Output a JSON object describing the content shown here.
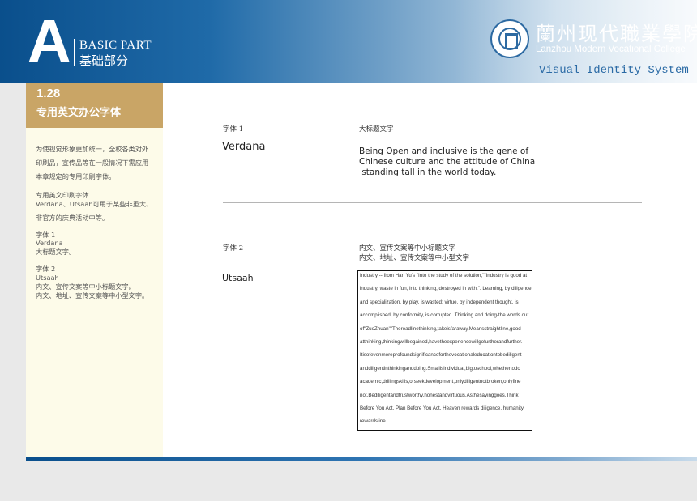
{
  "header": {
    "letter": "A",
    "part_en": "BASIC PART",
    "part_cn": "基础部分",
    "school_cn": "蘭州现代職業學院",
    "school_en": "Lanzhou Modern Vocational College",
    "system_title": "Visual Identity System"
  },
  "section": {
    "number": "1.28",
    "title": "专用英文办公字体"
  },
  "sidebar": {
    "para1": [
      "为使视觉形象更加统一，全校各类对外",
      "印刷品，宣传品等在一般情况下需应用",
      "本章规定的专用印刷字体。"
    ],
    "para2": [
      "专用英文印刷字体二",
      "Verdana、Utsaah可用于某些非重大、",
      "非官方的庆典活动中等。"
    ],
    "para3": [
      "字体 1",
      "Verdana",
      "大标题文字。"
    ],
    "para4": [
      "字体 2",
      "Utsaah",
      "内文、宣传文案等中小标题文字。",
      "内文、地址、宣传文案等中小型文字。"
    ]
  },
  "font1": {
    "label": "字体 1",
    "name": "Verdana",
    "usage": "大标题文字",
    "sample_lines": [
      "Being Open and inclusive is the gene of",
      "Chinese culture and the attitude of China",
      " standing tall in the world today."
    ]
  },
  "font2": {
    "label": "字体 2",
    "name": "Utsaah",
    "usage_lines": [
      "内文、宣传文案等中小标题文字",
      "内文、地址、宣传文案等中小型文字"
    ],
    "sample_lines": [
      "Industry -- from Han Yu's \"Into the study of the solution,\"\"Industry is good at",
      "industry, waste in fun, into thinking, destroyed in with.\". Learning, by diligence",
      "and specialization, by play, is wasted; virtue, by independent thought, is",
      "accomplished, by conformity, is corrupted. Thinking and doing-the words out",
      "of\"ZuoZhuan\"\"Theroadlinethinking,takeisfaraway.Meansstraightline,good",
      "atthinking,thinkingwillbegained,havetheexperiencewillgofurtherandfurther.",
      "Itisofevenmoreprofoundsignificanceforthevocationaleducationtobediligent",
      "anddiligentinthinkinganddoing.Smallisindividual,bigtoschool,whethertodo",
      "academic,drillingskills,orseekdevelopment,onlydiligentnotbroken,onlyfine",
      "not.Bediligentandtrustworthy,honestandvirtuous.Asthesayinggoes,Think",
      "Before You Act, Plan Before You Act. Heaven rewards diligence, humanity",
      "rewardsline."
    ]
  },
  "colors": {
    "brand_blue": "#0a4f8c",
    "gold": "#c9a566",
    "panel_cream": "#fdfbe9"
  }
}
